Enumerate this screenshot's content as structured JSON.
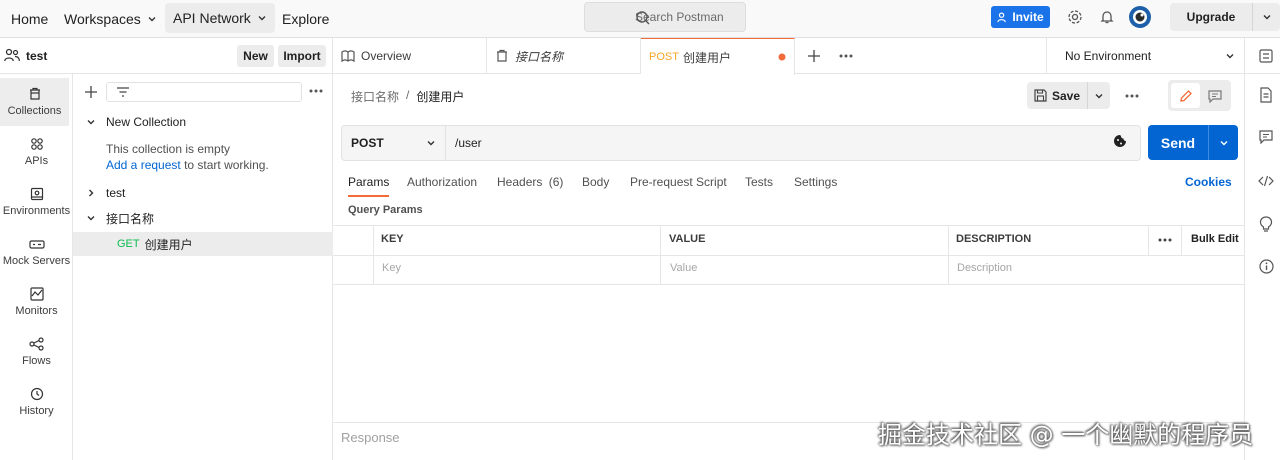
{
  "topbar": {
    "home": "Home",
    "workspaces": "Workspaces",
    "api_network": "API Network",
    "explore": "Explore",
    "search_placeholder": "Search Postman",
    "invite": "Invite",
    "upgrade": "Upgrade"
  },
  "workspace": {
    "name": "test",
    "new_label": "New",
    "import_label": "Import"
  },
  "rail": {
    "items": [
      {
        "label": "Collections",
        "icon": "trash-can-icon"
      },
      {
        "label": "APIs",
        "icon": "apis-icon"
      },
      {
        "label": "Environments",
        "icon": "environment-icon"
      },
      {
        "label": "Mock Servers",
        "icon": "server-icon"
      },
      {
        "label": "Monitors",
        "icon": "monitor-icon"
      },
      {
        "label": "Flows",
        "icon": "flows-icon"
      },
      {
        "label": "History",
        "icon": "history-icon"
      }
    ]
  },
  "tree": {
    "new_collection": "New Collection",
    "empty_text": "This collection is empty",
    "add_request_link": "Add a request",
    "add_request_suffix": "to start working.",
    "collection_test": "test",
    "collection_api": "接口名称",
    "request_method": "GET",
    "request_name": "创建用户"
  },
  "tabs": {
    "overview": "Overview",
    "tab2": "接口名称",
    "active_method": "POST",
    "active_name": "创建用户",
    "environment": "No Environment"
  },
  "request": {
    "breadcrumb_parent": "接口名称",
    "breadcrumb_sep": "/",
    "breadcrumb_current": "创建用户",
    "save": "Save",
    "method": "POST",
    "url": "/user",
    "send": "Send",
    "subtabs": [
      "Params",
      "Authorization",
      "Headers",
      "Body",
      "Pre-request Script",
      "Tests",
      "Settings"
    ],
    "headers_count": "(6)",
    "cookies": "Cookies",
    "query_params": "Query Params",
    "columns": [
      "KEY",
      "VALUE",
      "DESCRIPTION"
    ],
    "bulk_edit": "Bulk Edit",
    "placeholders": [
      "Key",
      "Value",
      "Description"
    ],
    "response": "Response"
  },
  "colors": {
    "accent": "#f26b3a",
    "send_blue": "#0265d2",
    "get_green": "#0cbb52"
  },
  "watermark": "掘金技术社区 @ 一个幽默的程序员"
}
